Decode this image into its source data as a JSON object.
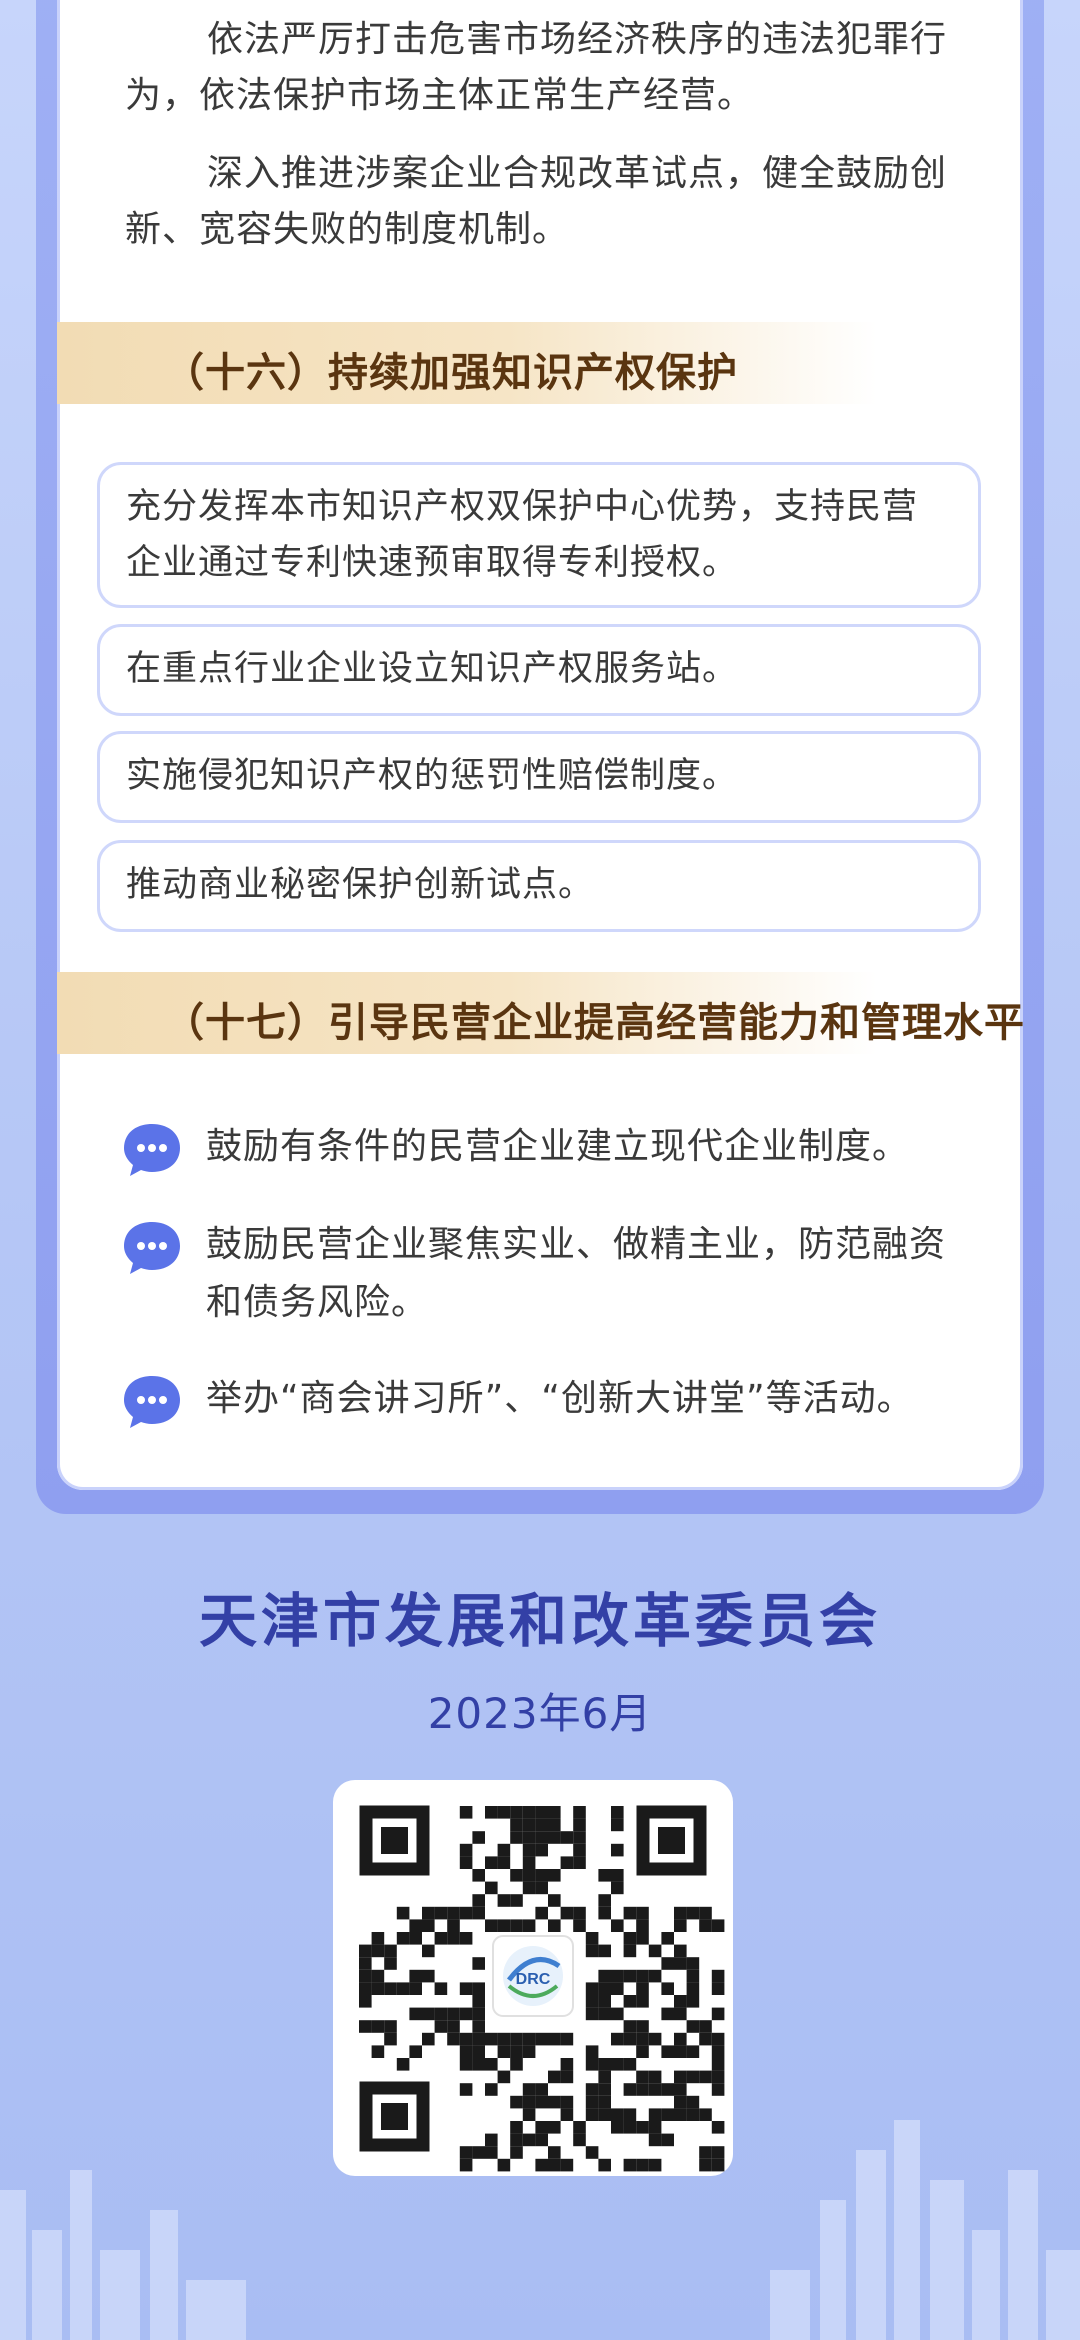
{
  "intro": {
    "paragraphs": [
      "依法严厉打击危害市场经济秩序的违法犯罪行为，依法保护市场主体正常生产经营。",
      "深入推进涉案企业合规改革试点，健全鼓励创新、宽容失败的制度机制。"
    ]
  },
  "section16": {
    "title": "（十六）持续加强知识产权保护",
    "items": [
      "充分发挥本市知识产权双保护中心优势，支持民营企业通过专利快速预审取得专利授权。",
      "在重点行业企业设立知识产权服务站。",
      "实施侵犯知识产权的惩罚性赔偿制度。",
      "推动商业秘密保护创新试点。"
    ]
  },
  "section17": {
    "title": "（十七）引导民营企业提高经营能力和管理水平",
    "items": [
      "鼓励有条件的民营企业建立现代企业制度。",
      "鼓励民营企业聚焦实业、做精主业，防范融资和债务风险。",
      "举办“商会讲习所”、“创新大讲堂”等活动。"
    ]
  },
  "footer": {
    "org": "天津市发展和改革委员会",
    "date": "2023年6月",
    "qr_logo_text": "DRC"
  },
  "colors": {
    "accent": "#3340a6",
    "section_text": "#5a3510",
    "bubble": "#5b73e8"
  }
}
